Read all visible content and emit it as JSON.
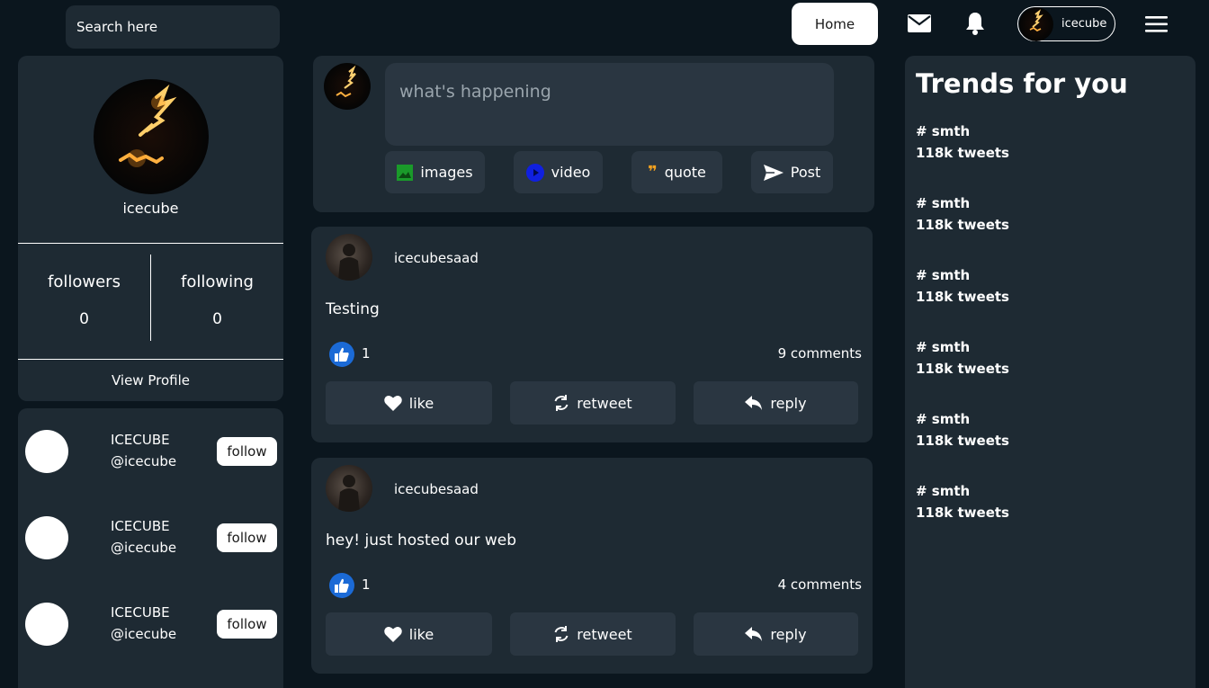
{
  "topbar": {
    "search_placeholder": "Search here",
    "home_label": "Home",
    "username": "icecube",
    "icons": [
      "mail-icon",
      "bell-icon",
      "menu-icon"
    ]
  },
  "profile": {
    "name": "icecube",
    "followers_label": "followers",
    "followers_count": "0",
    "following_label": "following",
    "following_count": "0",
    "view_profile_label": "View Profile"
  },
  "suggestions": [
    {
      "name": "ICECUBE",
      "handle": "@icecube",
      "button": "follow"
    },
    {
      "name": "ICECUBE",
      "handle": "@icecube",
      "button": "follow"
    },
    {
      "name": "ICECUBE",
      "handle": "@icecube",
      "button": "follow"
    }
  ],
  "composer": {
    "placeholder": "what's happening",
    "buttons": {
      "images": "images",
      "video": "video",
      "quote": "quote",
      "post": "Post"
    }
  },
  "posts": [
    {
      "user": "icecubesaad",
      "text": "Testing",
      "likes": "1",
      "comments": "9 comments",
      "actions": {
        "like": "like",
        "retweet": "retweet",
        "reply": "reply"
      }
    },
    {
      "user": "icecubesaad",
      "text": "hey! just hosted our web",
      "likes": "1",
      "comments": "4 comments",
      "actions": {
        "like": "like",
        "retweet": "retweet",
        "reply": "reply"
      }
    }
  ],
  "trends": {
    "title": "Trends for you",
    "items": [
      {
        "tag": "# smth",
        "count": "118k tweets"
      },
      {
        "tag": "# smth",
        "count": "118k tweets"
      },
      {
        "tag": "# smth",
        "count": "118k tweets"
      },
      {
        "tag": "# smth",
        "count": "118k tweets"
      },
      {
        "tag": "# smth",
        "count": "118k tweets"
      },
      {
        "tag": "# smth",
        "count": "118k tweets"
      }
    ]
  },
  "colors": {
    "background": "#0b161e",
    "card": "#1e2a33",
    "button": "#2a3641",
    "like_blue": "#1b6ad6",
    "quote_orange": "#f0a020",
    "images_green": "#1a9a2a",
    "video_blue": "#1020e0"
  }
}
